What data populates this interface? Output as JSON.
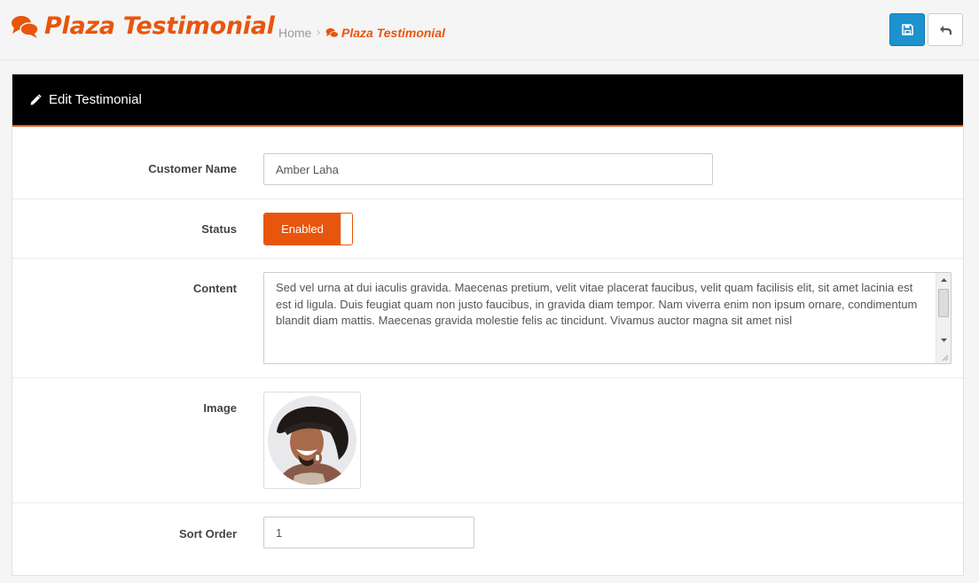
{
  "header": {
    "title": "Plaza Testimonial",
    "title_icon": "comments-icon",
    "breadcrumb": {
      "home": "Home",
      "separator": "›",
      "current": "Plaza Testimonial"
    },
    "buttons": {
      "save_icon": "floppy-disk-icon",
      "back_icon": "reply-icon"
    }
  },
  "panel": {
    "title": "Edit Testimonial",
    "title_icon": "pencil-icon"
  },
  "form": {
    "customer_name": {
      "label": "Customer Name",
      "value": "Amber Laha"
    },
    "status": {
      "label": "Status",
      "value": "Enabled",
      "on": true
    },
    "content": {
      "label": "Content",
      "value": "Sed vel urna at dui iaculis gravida. Maecenas pretium, velit vitae placerat faucibus, velit quam facilisis elit, sit amet lacinia est est id ligula. Duis feugiat quam non justo faucibus, in gravida diam tempor. Nam viverra enim non ipsum ornare, condimentum blandit diam mattis. Maecenas gravida molestie felis ac tincidunt. Vivamus auctor magna sit amet nisl"
    },
    "image": {
      "label": "Image",
      "subject": "customer-photo"
    },
    "sort_order": {
      "label": "Sort Order",
      "value": "1"
    }
  },
  "colors": {
    "accent": "#e8550c",
    "primary": "#1e91cf",
    "panel_heading": "#000000"
  }
}
